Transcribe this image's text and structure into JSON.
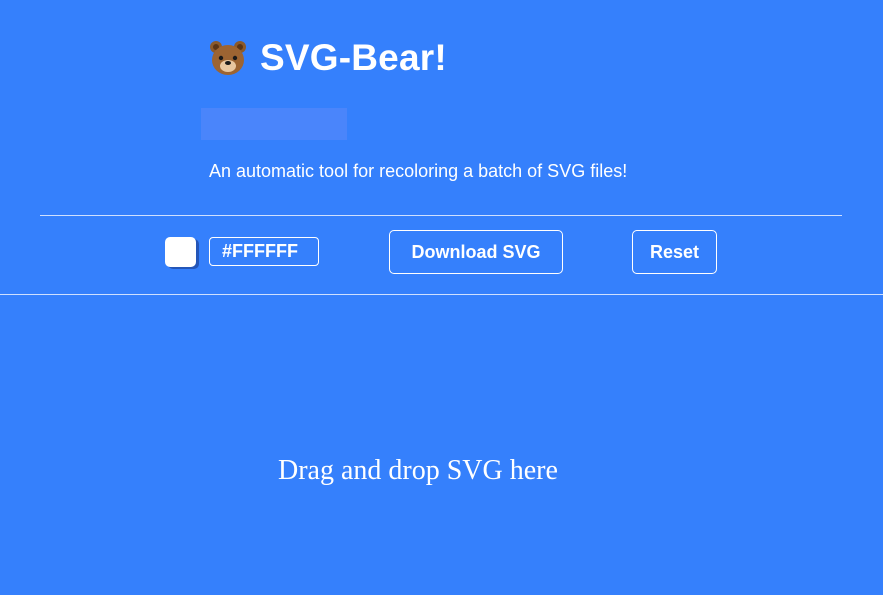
{
  "header": {
    "icon": "bear-face-icon",
    "title": "SVG-Bear!"
  },
  "tagline": "An automatic tool for recoloring a batch of SVG files!",
  "toolbar": {
    "color_value": "#FFFFFF",
    "download_label": "Download SVG",
    "reset_label": "Reset"
  },
  "dropzone": {
    "text": "Drag and drop SVG here"
  },
  "colors": {
    "background": "#3580fc",
    "banner": "#4a85fb",
    "selected_color": "#FFFFFF"
  }
}
